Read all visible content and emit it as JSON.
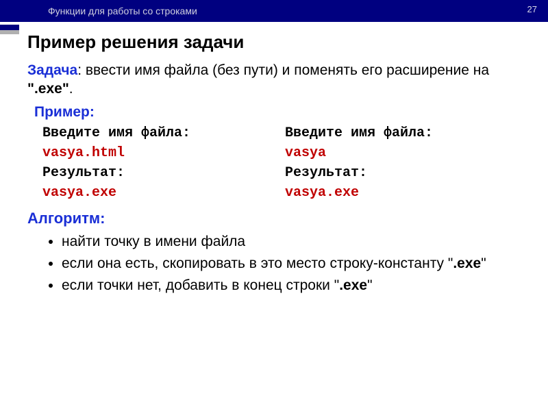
{
  "header": {
    "breadcrumb": "Функции для работы со строками",
    "slideNumber": "27"
  },
  "title": "Пример решения задачи",
  "task": {
    "label": "Задача",
    "text_before": ": ввести имя файла (без пути) и поменять его расширение на ",
    "ext_bold": "\".exe\"",
    "text_after": "."
  },
  "exampleLabel": "Пример:",
  "columns": {
    "left": {
      "prompt": "Введите имя файла:",
      "input": "vasya.html",
      "resultLabel": "Результат:",
      "result": "vasya.exe"
    },
    "right": {
      "prompt": "Введите имя файла:",
      "input": "vasya",
      "resultLabel": "Результат:",
      "result": "vasya.exe"
    }
  },
  "algorithm": {
    "label": "Алгоритм:",
    "items": [
      {
        "prefix": "найти точку в имени файла",
        "bold": "",
        "suffix": ""
      },
      {
        "prefix": "если она есть, скопировать в это место строку-константу \"",
        "bold": ".exe",
        "suffix": "\""
      },
      {
        "prefix": "если точки нет, добавить в конец строки \"",
        "bold": ".exe",
        "suffix": "\""
      }
    ]
  }
}
